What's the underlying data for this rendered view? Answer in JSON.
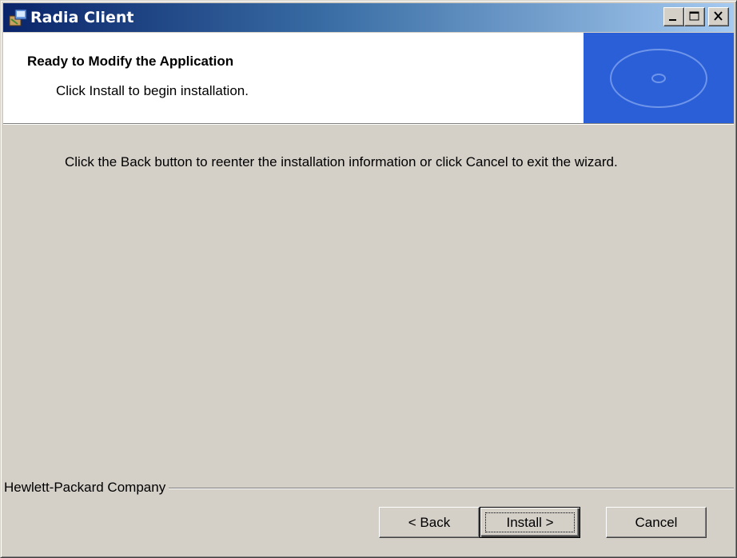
{
  "window": {
    "title": "Radia Client",
    "icon": "installer-app-icon",
    "controls": [
      "minimize-icon",
      "maximize-icon",
      "close-icon"
    ]
  },
  "header": {
    "title": "Ready to Modify the Application",
    "subtitle": "Click Install to begin installation.",
    "banner_graphic": "cd-disc-icon"
  },
  "body": {
    "message": "Click the Back button to reenter the installation information or click Cancel to exit the wizard."
  },
  "footer": {
    "company": "Hewlett-Packard Company",
    "buttons": {
      "back": "< Back",
      "install": "Install >",
      "cancel": "Cancel"
    },
    "default_button": "install"
  },
  "colors": {
    "title_gradient_start": "#0a246a",
    "title_gradient_end": "#a6caf0",
    "banner": "#2a5fd8",
    "face": "#d4d0c8"
  }
}
